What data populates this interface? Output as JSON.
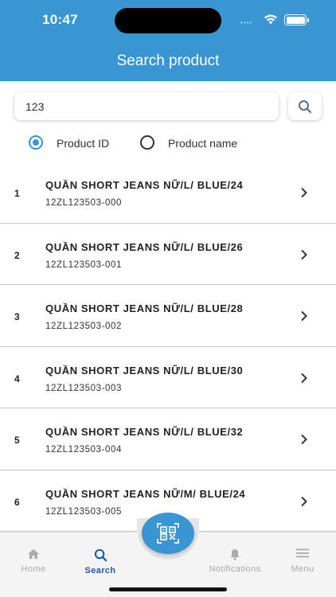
{
  "status": {
    "time": "10:47",
    "dots": "••••"
  },
  "header": {
    "title": "Search product"
  },
  "search": {
    "value": "123"
  },
  "filter": {
    "options": [
      {
        "label": "Product ID",
        "checked": true
      },
      {
        "label": "Product name",
        "checked": false
      }
    ]
  },
  "products": [
    {
      "index": "1",
      "name": "QUẦN SHORT JEANS NỮ/L/ BLUE/24",
      "code": "12ZL123503-000"
    },
    {
      "index": "2",
      "name": "QUẦN SHORT JEANS NỮ/L/ BLUE/26",
      "code": "12ZL123503-001"
    },
    {
      "index": "3",
      "name": "QUẦN SHORT JEANS NỮ/L/ BLUE/28",
      "code": "12ZL123503-002"
    },
    {
      "index": "4",
      "name": "QUẦN SHORT JEANS NỮ/L/ BLUE/30",
      "code": "12ZL123503-003"
    },
    {
      "index": "5",
      "name": "QUẦN SHORT JEANS NỮ/L/ BLUE/32",
      "code": "12ZL123503-004"
    },
    {
      "index": "6",
      "name": "QUẦN SHORT JEANS NỮ/M/ BLUE/24",
      "code": "12ZL123503-005"
    }
  ],
  "tabs": {
    "home": "Home",
    "search": "Search",
    "notifications": "Notifications",
    "menu": "Menu"
  },
  "colors": {
    "primary": "#3a96d2",
    "active_tab": "#1f5aa8",
    "inactive_tab": "#aaaaaa"
  }
}
